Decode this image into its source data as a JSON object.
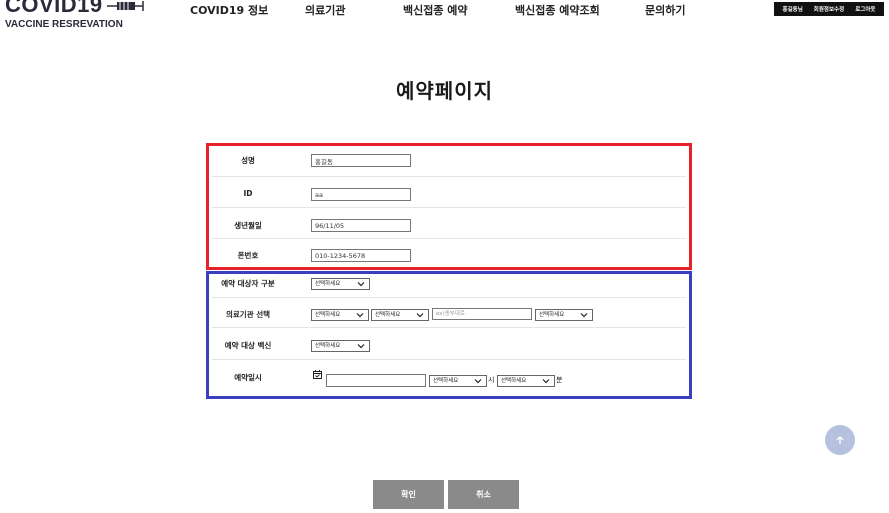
{
  "logo": {
    "title": "COVID19",
    "subtitle": "VACCINE RESREVATION"
  },
  "nav": [
    {
      "label": "COVID19 정보"
    },
    {
      "label": "의료기관"
    },
    {
      "label": "백신접종 예약"
    },
    {
      "label": "백신접종 예약조회"
    },
    {
      "label": "문의하기"
    }
  ],
  "user_menu": {
    "greeting": "홍길동님",
    "profile": "회원정보수정",
    "logout": "로그아웃"
  },
  "page_title": "예약페이지",
  "personal": {
    "name": {
      "label": "성명",
      "value": "홍길동"
    },
    "id": {
      "label": "ID",
      "value": "aa"
    },
    "birth": {
      "label": "생년월일",
      "value": "96/11/05"
    },
    "phone": {
      "label": "폰번호",
      "value": "010-1234-5678"
    }
  },
  "reservation": {
    "target_type": {
      "label": "예약 대상자 구분",
      "select": "선택하세요"
    },
    "facility": {
      "label": "의료기관 선택",
      "select1": "선택하세요",
      "select2": "선택하세요",
      "search_placeholder": "ex)종부대로",
      "select3": "선택하세요"
    },
    "vaccine": {
      "label": "예약 대상 백신",
      "select": "선택하세요"
    },
    "datetime": {
      "label": "예약일시",
      "date_value": "",
      "hour_select": "선택하세요",
      "hour_unit": "시",
      "minute_select": "선택하세요",
      "minute_unit": "분"
    }
  },
  "buttons": {
    "confirm": "확인",
    "cancel": "취소"
  },
  "colors": {
    "red_border": "#e8202a",
    "blue_border": "#3a3fbf",
    "button_gray": "#8a8a8a",
    "scroll_top": "#b6c2dd"
  }
}
